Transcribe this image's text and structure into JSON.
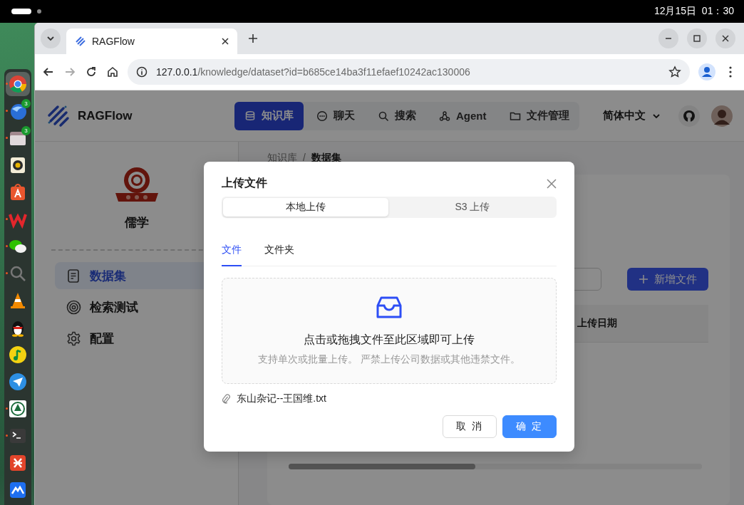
{
  "top_bar": {
    "clock": "12月15日  01：30"
  },
  "dock": {
    "items": [
      {
        "running": true,
        "selected": true
      },
      {
        "running": true,
        "selected": false,
        "badge": "3"
      },
      {
        "running": true,
        "selected": false,
        "badge": "3"
      },
      {
        "running": false,
        "selected": false
      },
      {
        "running": false,
        "selected": false
      },
      {
        "running": true,
        "selected": false
      },
      {
        "running": true,
        "selected": false
      },
      {
        "running": true,
        "selected": false
      },
      {
        "running": false,
        "selected": false
      },
      {
        "running": false,
        "selected": false
      },
      {
        "running": false,
        "selected": false
      },
      {
        "running": false,
        "selected": false
      },
      {
        "running": true,
        "selected": false
      },
      {
        "running": true,
        "selected": false
      },
      {
        "running": false,
        "selected": false
      },
      {
        "running": false,
        "selected": false
      }
    ]
  },
  "browser": {
    "tabs": [
      {
        "title": "RAGFlow",
        "selected": true
      }
    ],
    "address": {
      "host": "127.0.0.1",
      "path": "/knowledge/dataset?id=b685ce14ba3f11efaef10242ac130006"
    }
  },
  "app": {
    "brand": "RAGFlow",
    "nav": [
      {
        "label": "知识库",
        "selected": true
      },
      {
        "label": "聊天",
        "selected": false
      },
      {
        "label": "搜索",
        "selected": false
      },
      {
        "label": "Agent",
        "selected": false
      },
      {
        "label": "文件管理",
        "selected": false
      }
    ],
    "language": "简体中文"
  },
  "sidebar": {
    "name": "儒学",
    "items": [
      {
        "label": "数据集",
        "selected": true
      },
      {
        "label": "检索测试",
        "selected": false
      },
      {
        "label": "配置",
        "selected": false
      }
    ]
  },
  "dataset": {
    "breadcrumb": [
      "知识库",
      "数据集"
    ],
    "separator": "/",
    "add_button": "新增文件",
    "columns": [
      "上传日期"
    ]
  },
  "modal": {
    "title": "上传文件",
    "sources": [
      {
        "label": "本地上传",
        "selected": true
      },
      {
        "label": "S3 上传",
        "selected": false
      }
    ],
    "tabs": [
      {
        "label": "文件",
        "selected": true
      },
      {
        "label": "文件夹",
        "selected": false
      }
    ],
    "dropzone": {
      "text": "点击或拖拽文件至此区域即可上传",
      "hint": "支持单次或批量上传。 严禁上传公司数据或其他违禁文件。"
    },
    "files": [
      "东山杂记--王国维.txt"
    ],
    "buttons": [
      {
        "label": "取 消",
        "kind": "default"
      },
      {
        "label": "确 定",
        "kind": "primary"
      }
    ]
  }
}
